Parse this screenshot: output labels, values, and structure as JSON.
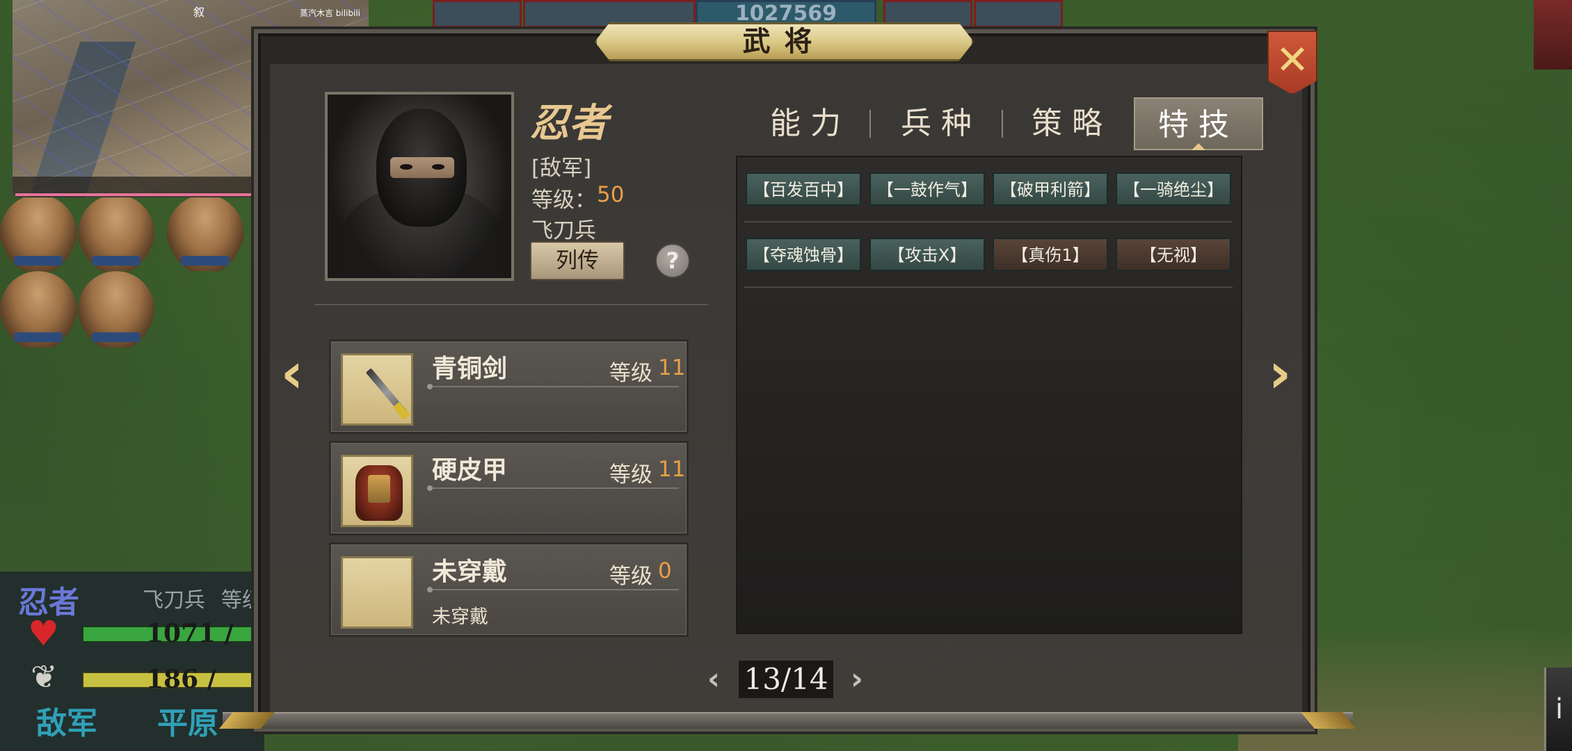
{
  "background": {
    "top_counter": "1027569"
  },
  "minimap": {
    "watermark": "蒸汽木言 bilibili",
    "compass": "叙"
  },
  "unit_panel": {
    "name": "忍者",
    "troop": "飞刀兵",
    "level_label": "等级",
    "hp": "1071 /",
    "mp": "186 /",
    "side": "敌军",
    "terrain": "平原"
  },
  "dialog": {
    "title": "武将",
    "close_icon": "close-x-icon",
    "hero": {
      "name": "忍者",
      "faction": "[敌军]",
      "level_label": "等级：",
      "level": "50",
      "troop": "飞刀兵",
      "bio_button": "列传",
      "help_button": "?"
    },
    "equipment": [
      {
        "name": "青铜剑",
        "level_label": "等级",
        "level": "11",
        "desc": "",
        "icon": "bronze-sword-icon"
      },
      {
        "name": "硬皮甲",
        "level_label": "等级",
        "level": "11",
        "desc": "",
        "icon": "leather-armor-icon"
      },
      {
        "name": "未穿戴",
        "level_label": "等级",
        "level": "0",
        "desc": "未穿戴",
        "icon": "empty-slot-icon"
      }
    ],
    "tabs": [
      {
        "label": "能力",
        "active": false
      },
      {
        "label": "兵种",
        "active": false
      },
      {
        "label": "策略",
        "active": false
      },
      {
        "label": "特技",
        "active": true
      }
    ],
    "skills": [
      [
        {
          "label": "【百发百中】",
          "tone": "teal"
        },
        {
          "label": "【一鼓作气】",
          "tone": "teal"
        },
        {
          "label": "【破甲利箭】",
          "tone": "teal"
        },
        {
          "label": "【一骑绝尘】",
          "tone": "teal"
        }
      ],
      [
        {
          "label": "【夺魂蚀骨】",
          "tone": "teal"
        },
        {
          "label": "【攻击X】",
          "tone": "teal"
        },
        {
          "label": "【真伤1】",
          "tone": "brown"
        },
        {
          "label": "【无视】",
          "tone": "brown"
        }
      ]
    ],
    "pager": {
      "prev": "‹",
      "current": "13/14",
      "next": "›"
    },
    "nav_prev": "‹",
    "nav_next": "›"
  },
  "colors": {
    "accent_gold": "#e8c890",
    "level_orange": "#e8a048",
    "enemy_blue": "#6a78d8",
    "skill_teal": "#4a625e",
    "skill_brown": "#5a4438"
  }
}
